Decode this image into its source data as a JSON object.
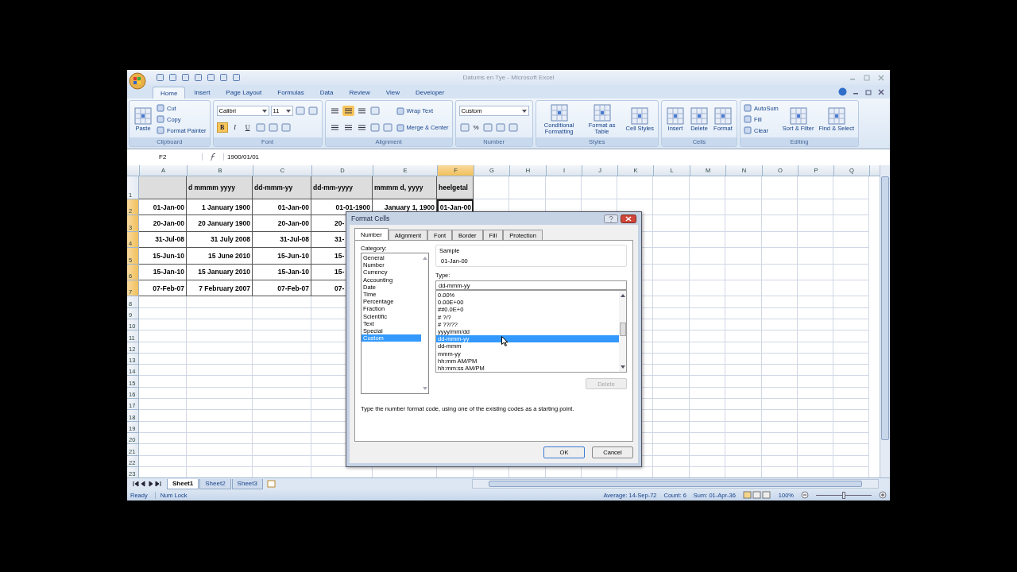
{
  "window": {
    "title": "Datums en Tye - Microsoft Excel"
  },
  "tabs": [
    {
      "label": "Home",
      "selected": true
    },
    {
      "label": "Insert",
      "selected": false
    },
    {
      "label": "Page Layout",
      "selected": false
    },
    {
      "label": "Formulas",
      "selected": false
    },
    {
      "label": "Data",
      "selected": false
    },
    {
      "label": "Review",
      "selected": false
    },
    {
      "label": "View",
      "selected": false
    },
    {
      "label": "Developer",
      "selected": false
    }
  ],
  "ribbon": [
    {
      "label": "Clipboard",
      "stacks": [
        [
          [
            {
              "kind": "large",
              "label": "Paste"
            }
          ]
        ],
        [
          [
            {
              "kind": "small",
              "label": "Cut"
            }
          ],
          [
            {
              "kind": "small",
              "label": "Copy"
            }
          ],
          [
            {
              "kind": "small",
              "label": "Format Painter"
            }
          ]
        ]
      ]
    },
    {
      "label": "Font",
      "stacks": [
        [
          [
            {
              "kind": "field",
              "value": "Calibri"
            },
            {
              "kind": "field",
              "value": "11"
            },
            {
              "kind": "icon"
            },
            {
              "kind": "icon"
            }
          ],
          [
            {
              "kind": "toggle",
              "label": "B",
              "selected": true
            },
            {
              "kind": "toggle",
              "label": "I",
              "selected": false
            },
            {
              "kind": "toggle",
              "label": "U",
              "selected": false
            },
            {
              "kind": "icon"
            },
            {
              "kind": "icon"
            },
            {
              "kind": "icon"
            }
          ]
        ]
      ]
    },
    {
      "label": "Alignment",
      "stacks": [
        [
          [
            {
              "kind": "align",
              "selected": false
            },
            {
              "kind": "align",
              "selected": true
            },
            {
              "kind": "align",
              "selected": false
            },
            {
              "kind": "icon"
            }
          ],
          [
            {
              "kind": "align",
              "selected": false
            },
            {
              "kind": "align",
              "selected": false
            },
            {
              "kind": "align",
              "selected": false
            },
            {
              "kind": "icon"
            },
            {
              "kind": "icon"
            }
          ]
        ],
        [
          [
            {
              "kind": "small",
              "label": "Wrap Text"
            }
          ],
          [
            {
              "kind": "small",
              "label": "Merge & Center"
            }
          ]
        ]
      ]
    },
    {
      "label": "Number",
      "stacks": [
        [
          [
            {
              "kind": "field",
              "value": "Custom"
            }
          ],
          [
            {
              "kind": "icon"
            },
            {
              "kind": "glyph",
              "label": "%"
            },
            {
              "kind": "icon"
            },
            {
              "kind": "icon"
            },
            {
              "kind": "icon"
            }
          ]
        ]
      ]
    },
    {
      "label": "Styles",
      "stacks": [
        [
          [
            {
              "kind": "large",
              "label": "Conditional Formatting"
            }
          ]
        ],
        [
          [
            {
              "kind": "large",
              "label": "Format as Table"
            }
          ]
        ],
        [
          [
            {
              "kind": "large",
              "label": "Cell Styles"
            }
          ]
        ]
      ]
    },
    {
      "label": "Cells",
      "stacks": [
        [
          [
            {
              "kind": "large",
              "label": "Insert"
            }
          ]
        ],
        [
          [
            {
              "kind": "large",
              "label": "Delete"
            }
          ]
        ],
        [
          [
            {
              "kind": "large",
              "label": "Format"
            }
          ]
        ]
      ]
    },
    {
      "label": "Editing",
      "stacks": [
        [
          [
            {
              "kind": "small",
              "label": "AutoSum"
            }
          ],
          [
            {
              "kind": "small",
              "label": "Fill"
            }
          ],
          [
            {
              "kind": "small",
              "label": "Clear"
            }
          ]
        ],
        [
          [
            {
              "kind": "large",
              "label": "Sort & Filter"
            }
          ]
        ],
        [
          [
            {
              "kind": "large",
              "label": "Find & Select"
            }
          ]
        ]
      ]
    }
  ],
  "formula_bar": {
    "name_box": "F2",
    "value": "1900/01/01"
  },
  "columns": [
    {
      "label": "A",
      "selected": false
    },
    {
      "label": "B",
      "selected": false
    },
    {
      "label": "C",
      "selected": false
    },
    {
      "label": "D",
      "selected": false
    },
    {
      "label": "E",
      "selected": false
    },
    {
      "label": "F",
      "selected": true
    },
    {
      "label": "G",
      "selected": false
    },
    {
      "label": "H",
      "selected": false
    },
    {
      "label": "I",
      "selected": false
    },
    {
      "label": "J",
      "selected": false
    },
    {
      "label": "K",
      "selected": false
    },
    {
      "label": "L",
      "selected": false
    },
    {
      "label": "M",
      "selected": false
    },
    {
      "label": "N",
      "selected": false
    },
    {
      "label": "O",
      "selected": false
    },
    {
      "label": "P",
      "selected": false
    },
    {
      "label": "Q",
      "selected": false
    }
  ],
  "rows": [
    {
      "label": "1",
      "selected": false,
      "kind": "header",
      "cells": [
        "d mmmm yyyy",
        "dd-mmm-yy",
        "dd-mm-yyyy",
        "mmmm d, yyyy",
        "heelgetal"
      ]
    },
    {
      "label": "2",
      "selected": true,
      "kind": "data",
      "cells": [
        "01-Jan-00",
        "1 January 1900",
        "01-Jan-00",
        "01-01-1900",
        "January 1, 1900",
        "01-Jan-00"
      ]
    },
    {
      "label": "3",
      "selected": true,
      "kind": "partial",
      "cells": [
        "20-Jan-00",
        "20 January 1900",
        "20-Jan-00",
        "20-"
      ]
    },
    {
      "label": "4",
      "selected": true,
      "kind": "partial",
      "cells": [
        "31-Jul-08",
        "31 July 2008",
        "31-Jul-08",
        "31-"
      ]
    },
    {
      "label": "5",
      "selected": true,
      "kind": "partial",
      "cells": [
        "15-Jun-10",
        "15 June 2010",
        "15-Jun-10",
        "15-"
      ]
    },
    {
      "label": "6",
      "selected": true,
      "kind": "partial",
      "cells": [
        "15-Jan-10",
        "15 January 2010",
        "15-Jan-10",
        "15-"
      ]
    },
    {
      "label": "7",
      "selected": true,
      "kind": "partial",
      "cells": [
        "07-Feb-07",
        "7 February 2007",
        "07-Feb-07",
        "07-"
      ]
    },
    {
      "label": "8",
      "selected": false,
      "kind": "empty"
    },
    {
      "label": "9",
      "selected": false,
      "kind": "empty"
    },
    {
      "label": "10",
      "selected": false,
      "kind": "empty"
    },
    {
      "label": "11",
      "selected": false,
      "kind": "empty"
    },
    {
      "label": "12",
      "selected": false,
      "kind": "empty"
    },
    {
      "label": "13",
      "selected": false,
      "kind": "empty"
    },
    {
      "label": "14",
      "selected": false,
      "kind": "empty"
    },
    {
      "label": "15",
      "selected": false,
      "kind": "empty"
    },
    {
      "label": "16",
      "selected": false,
      "kind": "empty"
    },
    {
      "label": "17",
      "selected": false,
      "kind": "empty"
    },
    {
      "label": "18",
      "selected": false,
      "kind": "empty"
    },
    {
      "label": "19",
      "selected": false,
      "kind": "empty"
    },
    {
      "label": "20",
      "selected": false,
      "kind": "empty"
    },
    {
      "label": "21",
      "selected": false,
      "kind": "empty"
    },
    {
      "label": "22",
      "selected": false,
      "kind": "empty"
    },
    {
      "label": "23",
      "selected": false,
      "kind": "empty"
    }
  ],
  "dialog": {
    "title": "Format Cells",
    "tabs": [
      {
        "label": "Number",
        "selected": true
      },
      {
        "label": "Alignment",
        "selected": false
      },
      {
        "label": "Font",
        "selected": false
      },
      {
        "label": "Border",
        "selected": false
      },
      {
        "label": "Fill",
        "selected": false
      },
      {
        "label": "Protection",
        "selected": false
      }
    ],
    "category": {
      "label": "Category:",
      "items": [
        {
          "label": "General",
          "selected": false
        },
        {
          "label": "Number",
          "selected": false
        },
        {
          "label": "Currency",
          "selected": false
        },
        {
          "label": "Accounting",
          "selected": false
        },
        {
          "label": "Date",
          "selected": false
        },
        {
          "label": "Time",
          "selected": false
        },
        {
          "label": "Percentage",
          "selected": false
        },
        {
          "label": "Fraction",
          "selected": false
        },
        {
          "label": "Scientific",
          "selected": false
        },
        {
          "label": "Text",
          "selected": false
        },
        {
          "label": "Special",
          "selected": false
        },
        {
          "label": "Custom",
          "selected": true
        }
      ]
    },
    "sample": {
      "label": "Sample",
      "value": "01-Jan-00"
    },
    "type": {
      "label": "Type:",
      "value": "dd-mmm-yy",
      "items": [
        {
          "label": "0.00%",
          "selected": false
        },
        {
          "label": "0.00E+00",
          "selected": false
        },
        {
          "label": "##0.0E+0",
          "selected": false
        },
        {
          "label": "# ?/?",
          "selected": false
        },
        {
          "label": "# ??/??",
          "selected": false
        },
        {
          "label": "yyyy/mm/dd",
          "selected": false
        },
        {
          "label": "dd-mmm-yy",
          "selected": true
        },
        {
          "label": "dd-mmm",
          "selected": false
        },
        {
          "label": "mmm-yy",
          "selected": false
        },
        {
          "label": "hh:mm AM/PM",
          "selected": false
        },
        {
          "label": "hh:mm:ss AM/PM",
          "selected": false
        }
      ]
    },
    "delete_button": {
      "label": "Delete",
      "disabled": true
    },
    "description": "Type the number format code, using one of the existing codes as a starting point.",
    "buttons": [
      "OK",
      "Cancel"
    ]
  },
  "sheets": [
    {
      "label": "Sheet1",
      "selected": true
    },
    {
      "label": "Sheet2",
      "selected": false
    },
    {
      "label": "Sheet3",
      "selected": false
    }
  ],
  "status_bar": {
    "mode": "Ready",
    "lock": "Num Lock",
    "average": "Average: 14-Sep-72",
    "count": "Count: 6",
    "sum": "Sum: 01-Apr-36",
    "zoom": "100%",
    "zoom_level": {
      "level": 0.5
    }
  }
}
